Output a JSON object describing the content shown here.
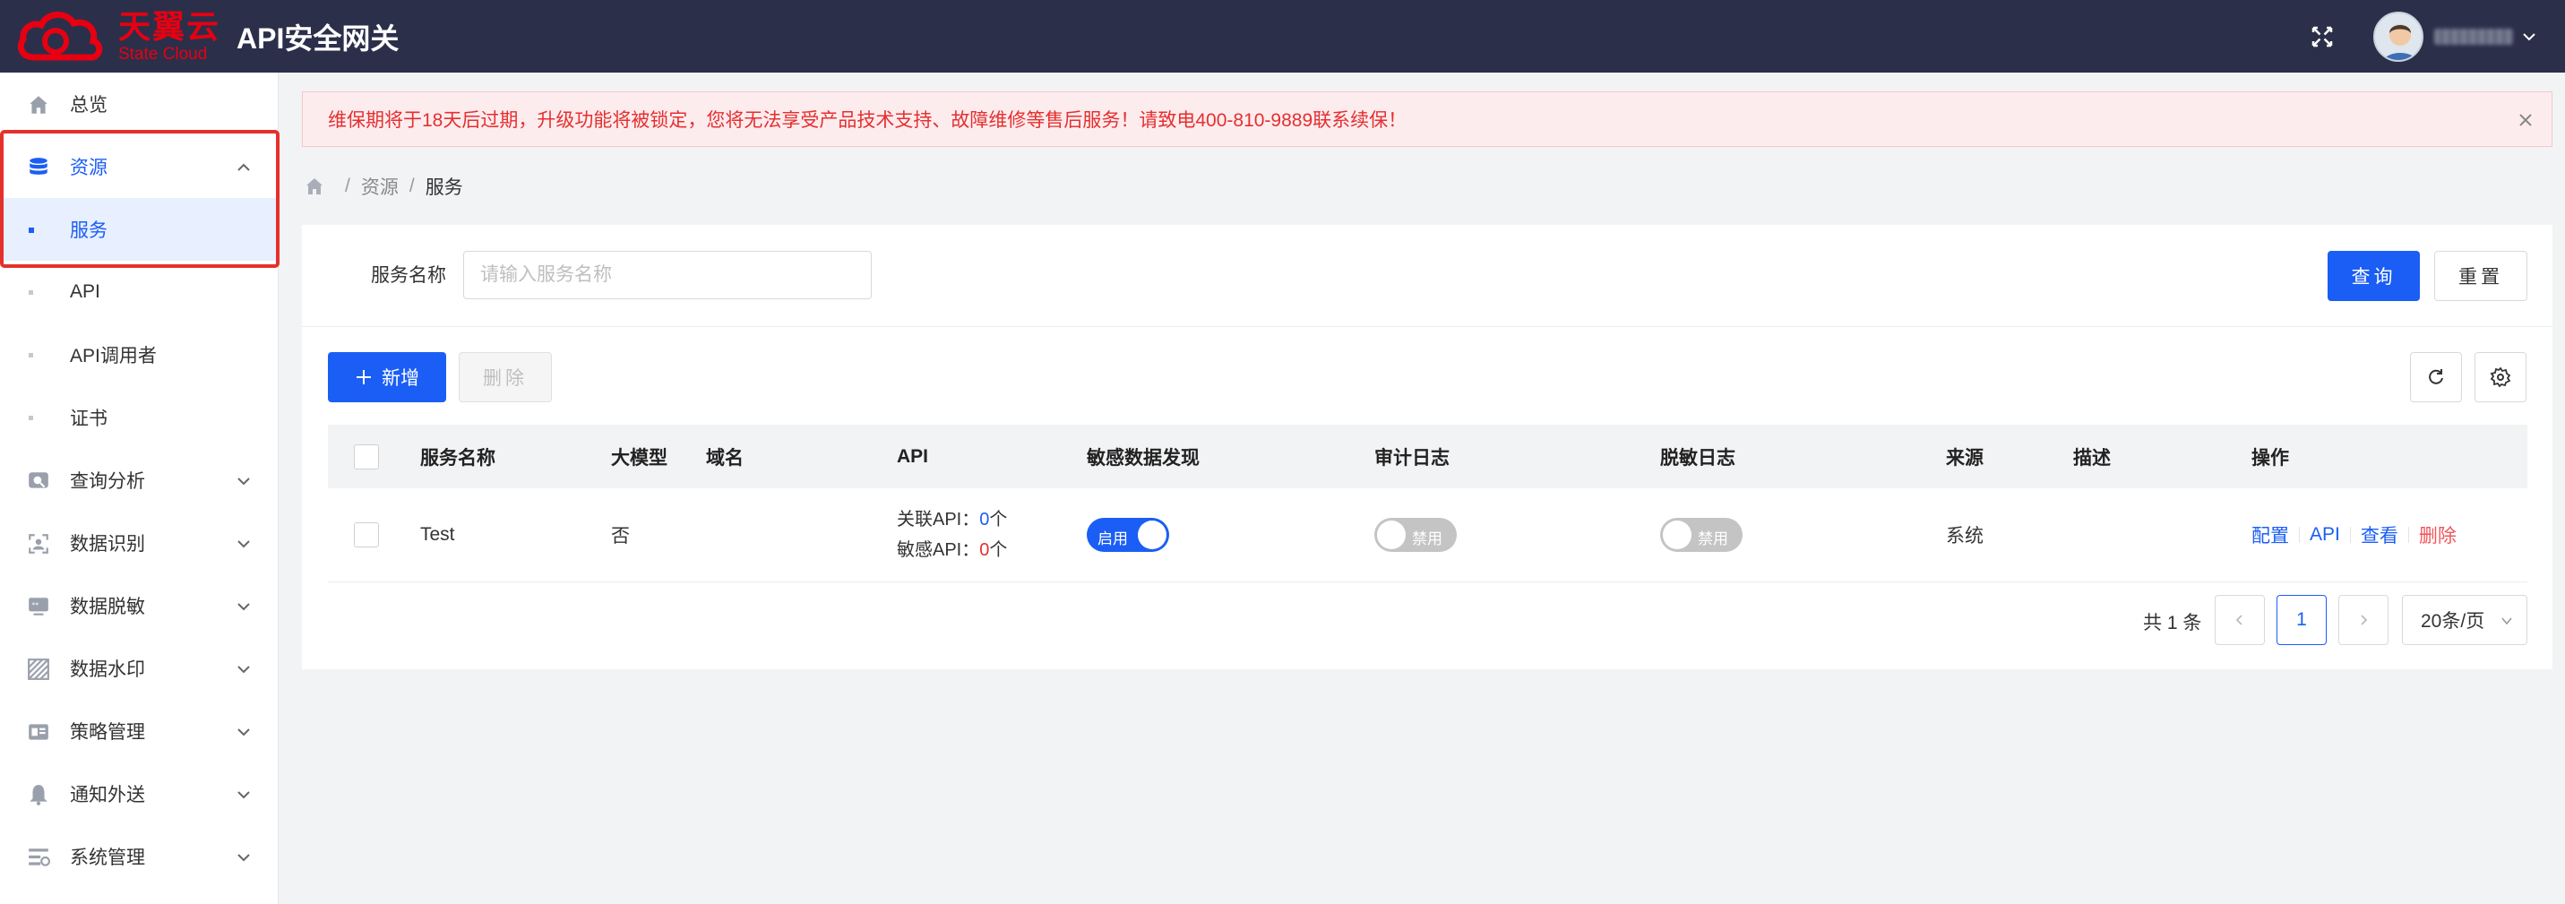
{
  "header": {
    "logo_cn": "天翼云",
    "logo_en": "State Cloud",
    "title": "API安全网关"
  },
  "sidebar": {
    "items": [
      {
        "label": "总览",
        "icon": "home-icon"
      },
      {
        "label": "资源",
        "icon": "database-icon",
        "expanded": true
      },
      {
        "label": "服务",
        "sub": true,
        "selected": true
      },
      {
        "label": "API",
        "sub": true
      },
      {
        "label": "API调用者",
        "sub": true
      },
      {
        "label": "证书",
        "sub": true
      },
      {
        "label": "查询分析",
        "icon": "search-analysis-icon"
      },
      {
        "label": "数据识别",
        "icon": "scan-icon"
      },
      {
        "label": "数据脱敏",
        "icon": "mask-icon"
      },
      {
        "label": "数据水印",
        "icon": "watermark-icon"
      },
      {
        "label": "策略管理",
        "icon": "policy-icon"
      },
      {
        "label": "通知外送",
        "icon": "bell-icon"
      },
      {
        "label": "系统管理",
        "icon": "system-icon"
      }
    ]
  },
  "alert": {
    "text": "维保期将于18天后过期，升级功能将被锁定，您将无法享受产品技术支持、故障维修等售后服务！请致电400-810-9889联系续保！"
  },
  "breadcrumb": {
    "items": [
      "资源",
      "服务"
    ],
    "separator": "/"
  },
  "search": {
    "label": "服务名称",
    "placeholder": "请输入服务名称",
    "value": "",
    "query_label": "查询",
    "reset_label": "重置"
  },
  "toolbar": {
    "add_label": "新增",
    "delete_label": "删除"
  },
  "table": {
    "columns": [
      "服务名称",
      "大模型",
      "域名",
      "API",
      "敏感数据发现",
      "审计日志",
      "脱敏日志",
      "来源",
      "描述",
      "操作"
    ],
    "rows": [
      {
        "name": "Test",
        "llm": "否",
        "domain": "",
        "api_linked_label": "关联API：",
        "api_linked_count": "0",
        "api_sensitive_label": "敏感API：",
        "api_sensitive_count": "0",
        "api_unit": "个",
        "sensitive_discovery": {
          "on": true,
          "label": "启用"
        },
        "audit_log": {
          "on": false,
          "label": "禁用"
        },
        "mask_log": {
          "on": false,
          "label": "禁用"
        },
        "source": "系统",
        "description": "",
        "actions": [
          "配置",
          "API",
          "查看",
          "删除"
        ]
      }
    ]
  },
  "pagination": {
    "total_text": "共 1 条",
    "current_page": "1",
    "page_size": "20条/页"
  },
  "colors": {
    "primary": "#1b5ef5",
    "header_bg": "#2b2f4a",
    "brand_red": "#e60012",
    "alert_text": "#e52f2f",
    "danger": "#f0555b"
  }
}
